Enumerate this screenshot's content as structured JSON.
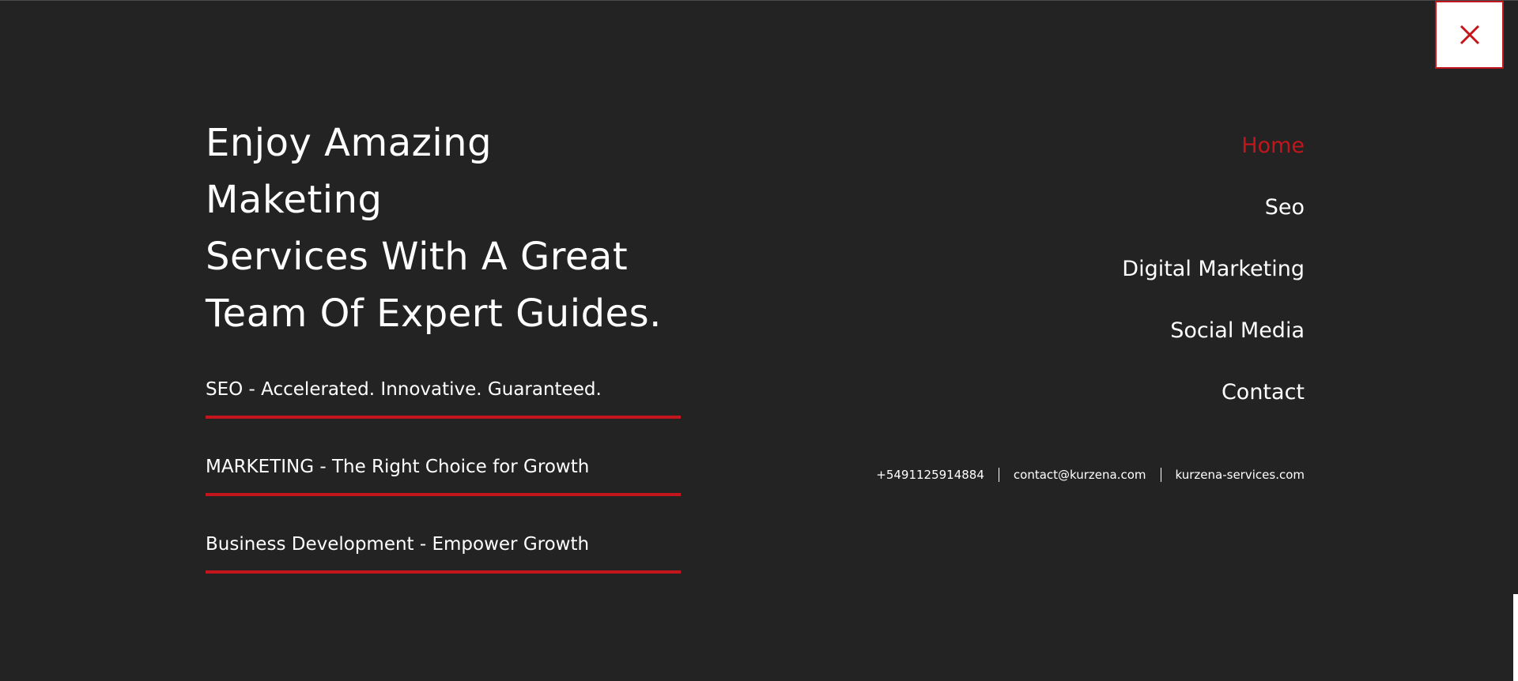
{
  "close": {
    "icon": "close-icon",
    "color": "#c3161c"
  },
  "headline": {
    "line1": "Enjoy Amazing Maketing",
    "line2": "Services With A Great",
    "line3": "Team Of Expert Guides."
  },
  "services": [
    {
      "label": "SEO - Accelerated. Innovative. Guaranteed."
    },
    {
      "label": "MARKETING - The Right Choice for Growth"
    },
    {
      "label": "Business Development - Empower Growth"
    }
  ],
  "nav": {
    "items": [
      {
        "label": "Home",
        "active": true
      },
      {
        "label": "Seo"
      },
      {
        "label": "Digital Marketing"
      },
      {
        "label": "Social Media"
      },
      {
        "label": "Contact"
      }
    ]
  },
  "contact": {
    "phone": "+5491125914884",
    "email": "contact@kurzena.com",
    "website": "kurzena-services.com"
  },
  "colors": {
    "background": "#232323",
    "accent": "#c3161c",
    "text": "#ffffff"
  }
}
